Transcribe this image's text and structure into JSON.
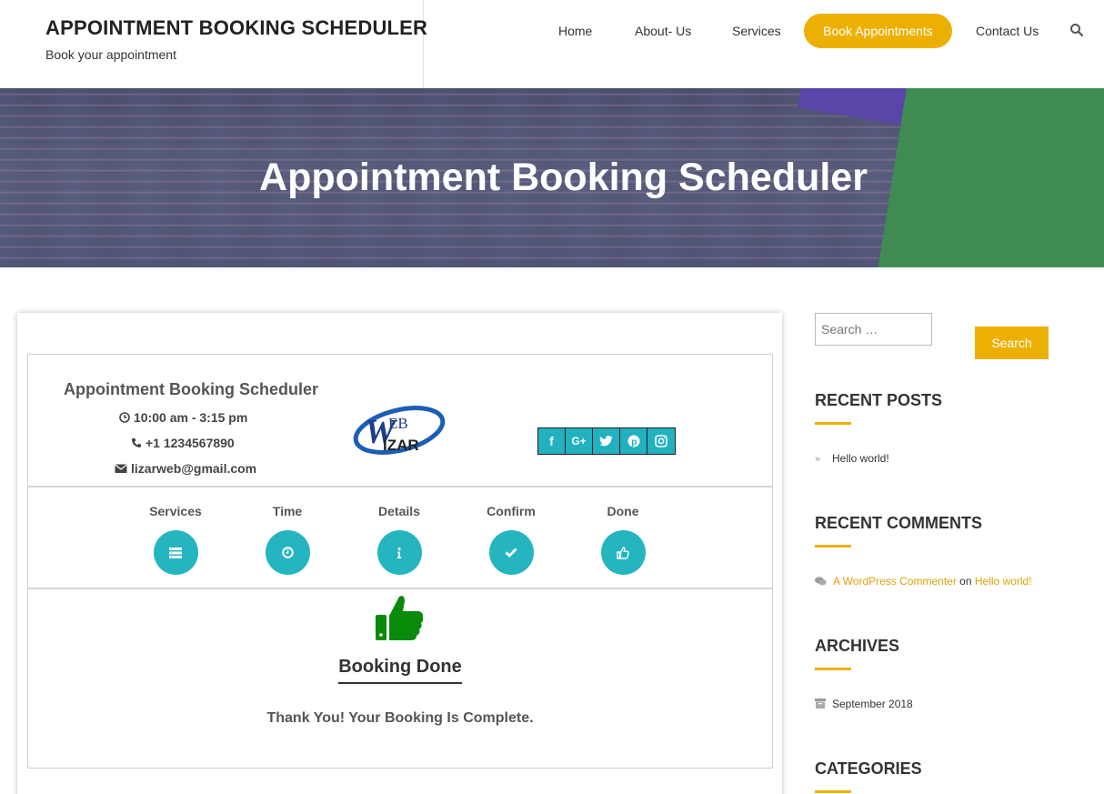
{
  "site": {
    "title": "APPOINTMENT BOOKING SCHEDULER",
    "tagline": "Book your appointment"
  },
  "nav": {
    "items": [
      {
        "label": "Home"
      },
      {
        "label": "About- Us"
      },
      {
        "label": "Services"
      },
      {
        "label": "Book Appointments",
        "active": true
      },
      {
        "label": "Contact Us"
      }
    ],
    "search_icon": "search-icon"
  },
  "hero": {
    "title": "Appointment Booking Scheduler"
  },
  "business": {
    "name": "Appointment Booking Scheduler",
    "hours": "10:00 am - 3:15 pm",
    "phone": "+1 1234567890",
    "email": "lizarweb@gmail.com",
    "logo_text_top": "EB",
    "logo_text_bottom": "IZAR"
  },
  "social": [
    "facebook-icon",
    "google-plus-icon",
    "twitter-icon",
    "pinterest-icon",
    "instagram-icon"
  ],
  "steps": [
    {
      "label": "Services",
      "icon": "list-icon"
    },
    {
      "label": "Time",
      "icon": "clock-icon"
    },
    {
      "label": "Details",
      "icon": "info-icon"
    },
    {
      "label": "Confirm",
      "icon": "check-icon"
    },
    {
      "label": "Done",
      "icon": "thumbs-up-icon"
    }
  ],
  "done": {
    "title": "Booking Done",
    "message": "Thank You! Your Booking Is Complete."
  },
  "sidebar": {
    "search_placeholder": "Search …",
    "search_button": "Search",
    "recent_posts_title": "RECENT POSTS",
    "recent_posts": [
      "Hello world!"
    ],
    "recent_comments_title": "RECENT COMMENTS",
    "comment_author": "A WordPress Commenter",
    "comment_on": "on",
    "comment_post": "Hello world!",
    "archives_title": "ARCHIVES",
    "archives": [
      "September 2018"
    ],
    "categories_title": "CATEGORIES"
  },
  "colors": {
    "accent": "#ecb005",
    "teal": "#24b5c1",
    "success_green": "#0a8a0a"
  }
}
